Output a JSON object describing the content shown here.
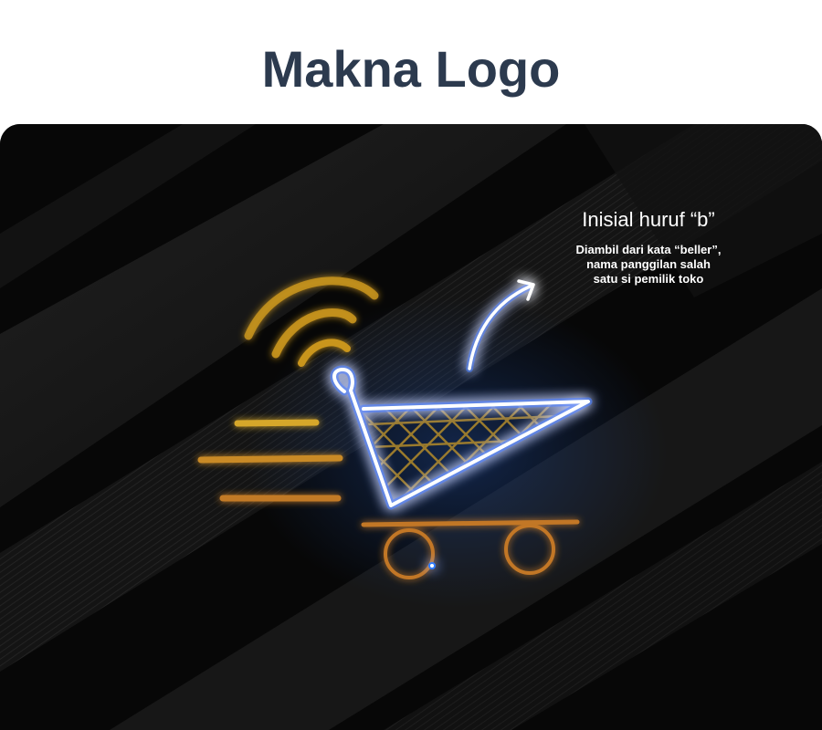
{
  "header": {
    "title": "Makna Logo"
  },
  "annotation": {
    "title": "Inisial huruf “b”",
    "lines": [
      "Diambil dari kata “beller”,",
      "nama panggilan salah",
      "satu si pemilik toko"
    ]
  },
  "colors": {
    "page_background": "#ffffff",
    "title_text": "#2c3a4e",
    "panel_background": "#080808",
    "neon_blue": "#3a8dff",
    "neon_yellow": "#d4a52a",
    "neon_orange": "#c97a22",
    "annotation_text": "#ffffff"
  },
  "icons": [
    "wifi-signal-icon",
    "speed-lines-icon",
    "shopping-cart-icon",
    "arrow-icon"
  ]
}
